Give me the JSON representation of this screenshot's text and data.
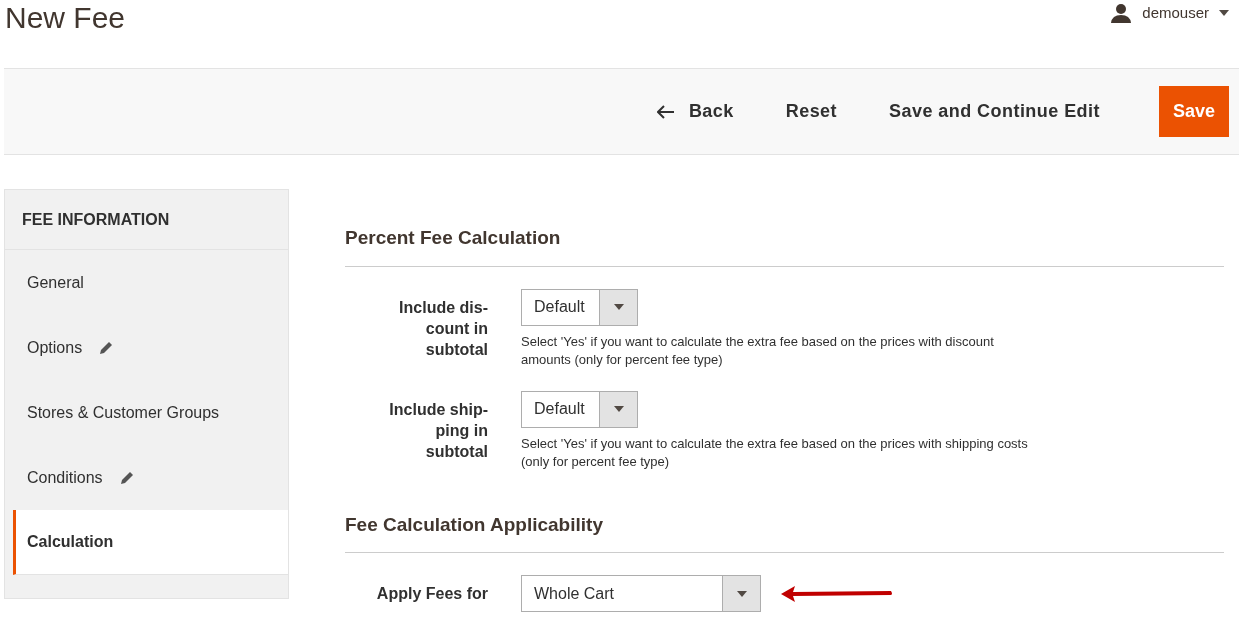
{
  "page_title": "New Fee",
  "user": {
    "name": "demouser"
  },
  "actions": [
    {
      "label": "Back",
      "kind": "back"
    },
    {
      "label": "Reset",
      "kind": "plain"
    },
    {
      "label": "Save and Continue Edit",
      "kind": "plain"
    },
    {
      "label": "Save",
      "kind": "primary"
    }
  ],
  "sidebar": {
    "title": "FEE INFORMATION",
    "items": [
      {
        "label": "General",
        "edited": false,
        "selected": false
      },
      {
        "label": "Options",
        "edited": true,
        "selected": false
      },
      {
        "label": "Stores & Customer Groups",
        "edited": false,
        "selected": false
      },
      {
        "label": "Conditions",
        "edited": true,
        "selected": false
      },
      {
        "label": "Calculation",
        "edited": false,
        "selected": true
      }
    ]
  },
  "sections": [
    {
      "title": "Percent Fee Calculation",
      "fields": [
        {
          "label_lines": [
            "Include dis-",
            "count in",
            "subtotal"
          ],
          "value": "Default",
          "wide": false,
          "note": "Select 'Yes' if you want to calculate the extra fee based on the prices with discount amounts (only for percent fee type)"
        },
        {
          "label_lines": [
            "Include ship-",
            "ping in",
            "subtotal"
          ],
          "value": "Default",
          "wide": false,
          "note": "Select 'Yes' if you want to calculate the extra fee based on the prices with shipping costs (only for percent fee type)"
        }
      ]
    },
    {
      "title": "Fee Calculation Applicability",
      "fields": [
        {
          "label_lines": [
            "Apply Fees for"
          ],
          "value": "Whole Cart",
          "wide": true,
          "pointer": true
        }
      ]
    }
  ]
}
